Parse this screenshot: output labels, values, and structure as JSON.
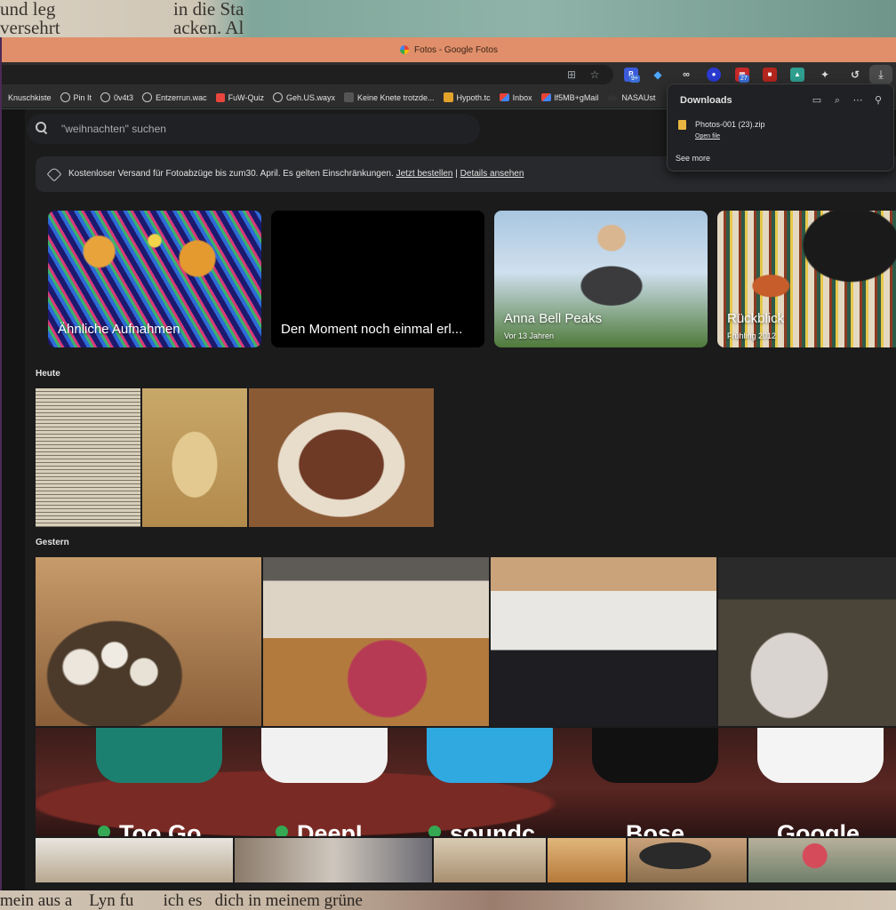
{
  "desktop": {
    "top_text_left": "und leg\nversehrt",
    "top_text_right": "in die Sta\nacken. Al",
    "bottom_text": "mein aus a    Lyn fu       ich es   dich in meinem grüne"
  },
  "window": {
    "title": "Fotos - Google Fotos"
  },
  "extensions": {
    "badge_1": "9+",
    "badge_2": "27"
  },
  "bookmarks": [
    {
      "label": "Knuschkiste"
    },
    {
      "label": "Pin It"
    },
    {
      "label": "0v4t3"
    },
    {
      "label": "Entzerrun.wac"
    },
    {
      "label": "FuW-Quiz"
    },
    {
      "label": "Geh.US.wayx"
    },
    {
      "label": "Keine Knete trotzde..."
    },
    {
      "label": "Hypoth.tc"
    },
    {
      "label": "Inbox"
    },
    {
      "label": "lf5MB+gMail"
    },
    {
      "label": "NASAUst"
    }
  ],
  "search": {
    "placeholder": "\"weihnachten\" suchen"
  },
  "promo": {
    "text": "Kostenloser Versand für Fotoabzüge bis zum30. April. Es gelten Einschränkungen.",
    "link_order": "Jetzt bestellen",
    "separator": "|",
    "link_details": "Details ansehen"
  },
  "memories": [
    {
      "title": "Ähnliche Aufnahmen",
      "subtitle": ""
    },
    {
      "title": "Den Moment noch einmal erl...",
      "subtitle": ""
    },
    {
      "title": "Anna Bell Peaks",
      "subtitle": "Vor 13 Jahren"
    },
    {
      "title": "Rückblick",
      "subtitle": "Frühling 2012"
    }
  ],
  "sections": {
    "today": "Heute",
    "yesterday": "Gestern"
  },
  "apps_screenshot": {
    "labels": [
      "Too Go",
      "DeepL",
      "soundc",
      "Bose",
      "Google"
    ]
  },
  "downloads": {
    "title": "Downloads",
    "file_name": "Photos-001 (23).zip",
    "open_file": "Open file",
    "see_more": "See more"
  }
}
